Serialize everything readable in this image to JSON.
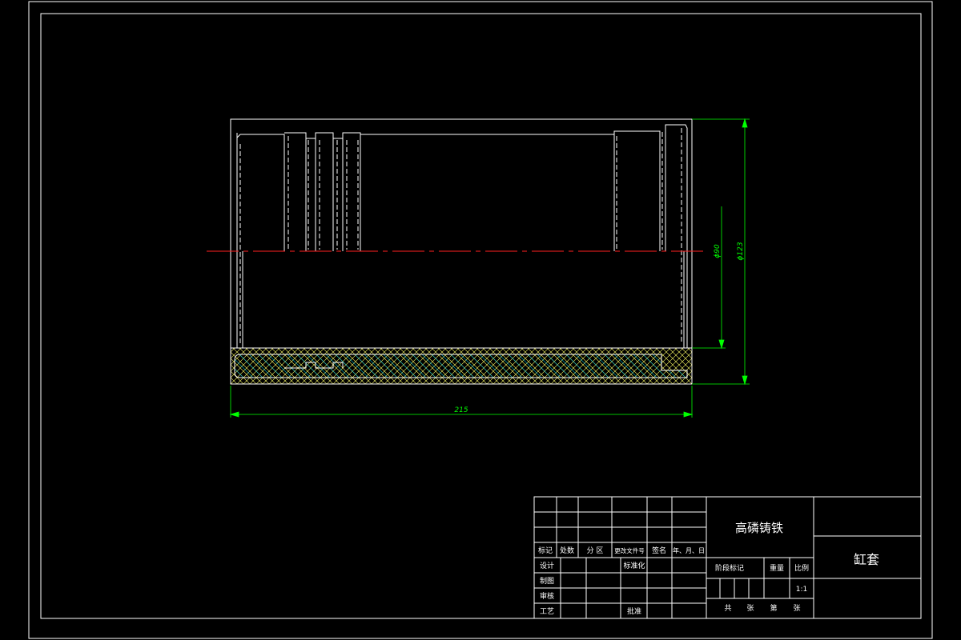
{
  "drawing": {
    "part_name": "缸套",
    "material": "高磷铸铁",
    "scale": "1:1",
    "colors": {
      "background": "#000000",
      "frame": "#ffffff",
      "dimension": "#00ff00",
      "centerline": "#ff0000",
      "hatch": "#ffff66"
    },
    "dimensions": {
      "length": "215",
      "inner_diameter": "ϕ90",
      "outer_diameter": "ϕ123"
    }
  },
  "title_block": {
    "row_labels": {
      "mark": "标记",
      "count": "处数",
      "zone": "分 区",
      "change_doc": "更改文件号",
      "signature": "签名",
      "date": "年、月、日"
    },
    "roles": {
      "design": "设计",
      "standardization": "标准化",
      "drafting": "制图",
      "review": "审核",
      "process": "工艺",
      "approve": "批准"
    },
    "stage_mark": "阶段标记",
    "weight": "重量",
    "scale_label": "比例",
    "sheets": {
      "total": "共",
      "sheet_unit": "张",
      "page": "第",
      "page_unit": "张"
    }
  }
}
